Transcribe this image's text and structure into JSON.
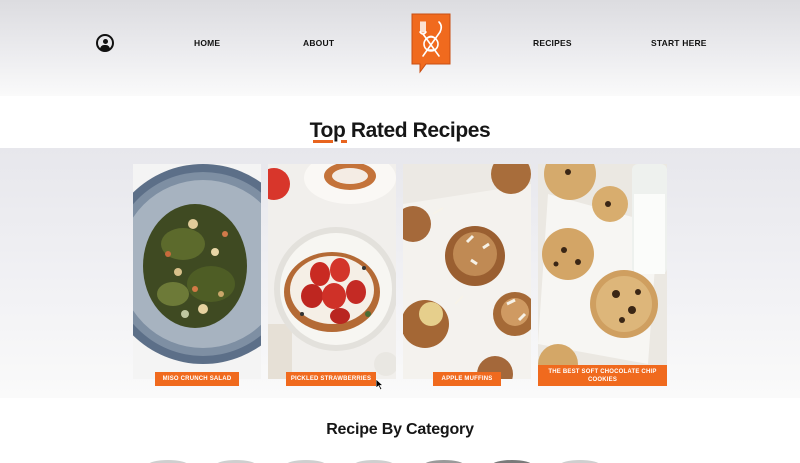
{
  "nav": {
    "home": "HOME",
    "about": "ABOUT",
    "recipes": "RECIPES",
    "start_here": "START HERE",
    "profile_icon": "user-circle-icon",
    "logo_icon": "chef-bag-fork-logo"
  },
  "top_rated": {
    "title": "Top Rated Recipes",
    "cards": [
      {
        "label": "MISO CRUNCH SALAD"
      },
      {
        "label": "PICKLED STRAWBERRIES"
      },
      {
        "label": "APPLE MUFFINS"
      },
      {
        "label": "THE BEST SOFT CHOCOLATE CHIP COOKIES"
      }
    ]
  },
  "category": {
    "title": "Recipe By Category"
  },
  "colors": {
    "accent": "#f06a1e",
    "text": "#111111"
  }
}
